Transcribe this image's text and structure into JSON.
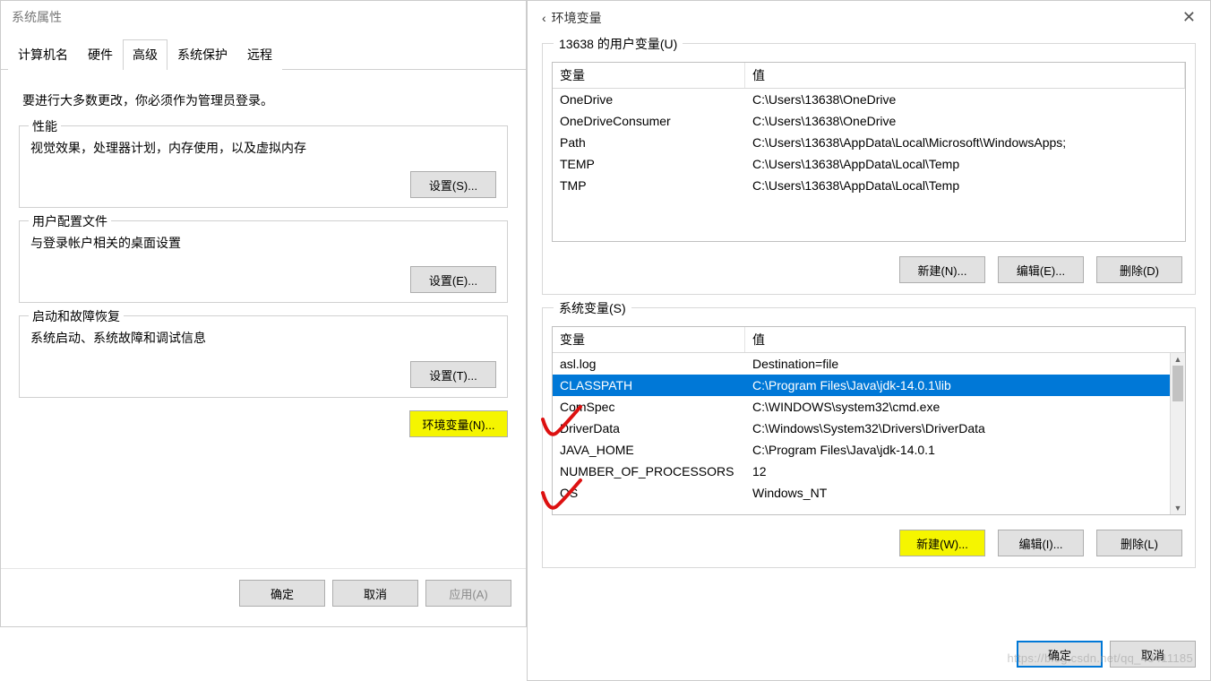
{
  "left": {
    "title": "系统属性",
    "tabs": [
      "计算机名",
      "硬件",
      "高级",
      "系统保护",
      "远程"
    ],
    "active_tab_index": 2,
    "admin_note": "要进行大多数更改，你必须作为管理员登录。",
    "performance": {
      "title": "性能",
      "desc": "视觉效果，处理器计划，内存使用，以及虚拟内存",
      "button": "设置(S)..."
    },
    "user_profile": {
      "title": "用户配置文件",
      "desc": "与登录帐户相关的桌面设置",
      "button": "设置(E)..."
    },
    "startup": {
      "title": "启动和故障恢复",
      "desc": "系统启动、系统故障和调试信息",
      "button": "设置(T)..."
    },
    "env_button": "环境变量(N)...",
    "ok": "确定",
    "cancel": "取消",
    "apply": "应用(A)"
  },
  "right": {
    "title": "环境变量",
    "user_group_title": "13638 的用户变量(U)",
    "sys_group_title": "系统变量(S)",
    "header": {
      "name": "变量",
      "value": "值"
    },
    "user_vars": [
      {
        "name": "OneDrive",
        "value": "C:\\Users\\13638\\OneDrive"
      },
      {
        "name": "OneDriveConsumer",
        "value": "C:\\Users\\13638\\OneDrive"
      },
      {
        "name": "Path",
        "value": "C:\\Users\\13638\\AppData\\Local\\Microsoft\\WindowsApps;"
      },
      {
        "name": "TEMP",
        "value": "C:\\Users\\13638\\AppData\\Local\\Temp"
      },
      {
        "name": "TMP",
        "value": "C:\\Users\\13638\\AppData\\Local\\Temp"
      }
    ],
    "sys_vars": [
      {
        "name": "asl.log",
        "value": "Destination=file"
      },
      {
        "name": "CLASSPATH",
        "value": "C:\\Program Files\\Java\\jdk-14.0.1\\lib"
      },
      {
        "name": "ComSpec",
        "value": "C:\\WINDOWS\\system32\\cmd.exe"
      },
      {
        "name": "DriverData",
        "value": "C:\\Windows\\System32\\Drivers\\DriverData"
      },
      {
        "name": "JAVA_HOME",
        "value": "C:\\Program Files\\Java\\jdk-14.0.1"
      },
      {
        "name": "NUMBER_OF_PROCESSORS",
        "value": "12"
      },
      {
        "name": "OS",
        "value": "Windows_NT"
      }
    ],
    "sys_selected_index": 1,
    "user_buttons": {
      "new": "新建(N)...",
      "edit": "编辑(E)...",
      "delete": "删除(D)"
    },
    "sys_buttons": {
      "new": "新建(W)...",
      "edit": "编辑(I)...",
      "delete": "删除(L)"
    },
    "ok": "确定",
    "cancel": "取消"
  },
  "watermark": "https://blog.csdn.net/qq_43411185"
}
